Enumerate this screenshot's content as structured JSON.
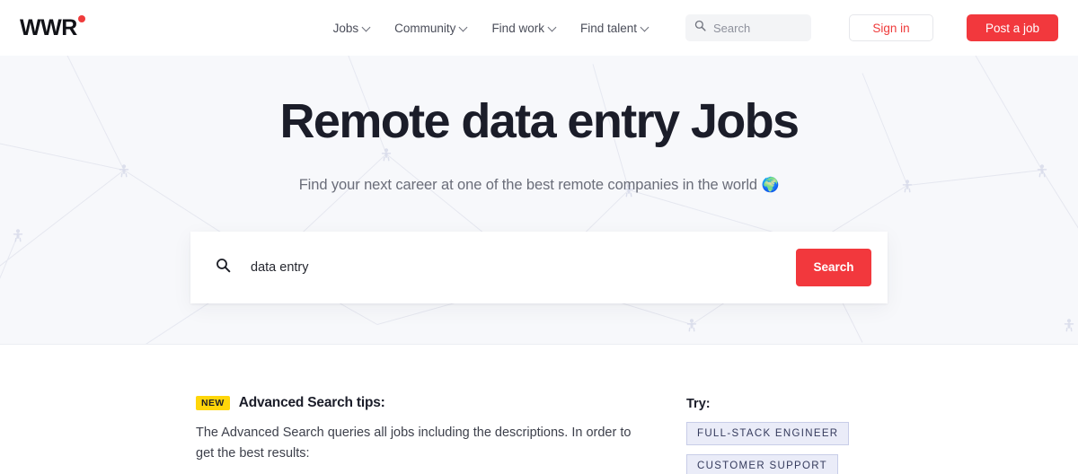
{
  "header": {
    "logo_text": "WWR",
    "nav": [
      {
        "label": "Jobs",
        "icon": "chevron-down-icon"
      },
      {
        "label": "Community",
        "icon": "chevron-down-icon"
      },
      {
        "label": "Find work",
        "icon": "chevron-down-icon"
      },
      {
        "label": "Find talent",
        "icon": "chevron-down-icon"
      }
    ],
    "search": {
      "placeholder": "Search",
      "value": "",
      "icon": "search-icon"
    },
    "sign_in_label": "Sign in",
    "post_job_label": "Post a job"
  },
  "hero": {
    "title": "Remote data entry Jobs",
    "subtitle": "Find your next career at one of the best remote companies in the world",
    "subtitle_emoji": "🌍",
    "search": {
      "icon": "search-icon",
      "value": "data entry",
      "placeholder": "Search",
      "button_label": "Search"
    }
  },
  "tips": {
    "badge": "NEW",
    "title": "Advanced Search tips:",
    "body": "The Advanced Search queries all jobs including the descriptions. In order to get the best results:",
    "try_label": "Try:",
    "suggestions": [
      "FULL-STACK ENGINEER",
      "CUSTOMER SUPPORT"
    ]
  },
  "colors": {
    "accent_red": "#f2383d",
    "badge_yellow": "#ffd60a",
    "chip_bg": "#eaecf8",
    "chip_border": "#c8cde8",
    "hero_bg": "#f7f8fb",
    "text_dark": "#1b1d29"
  }
}
